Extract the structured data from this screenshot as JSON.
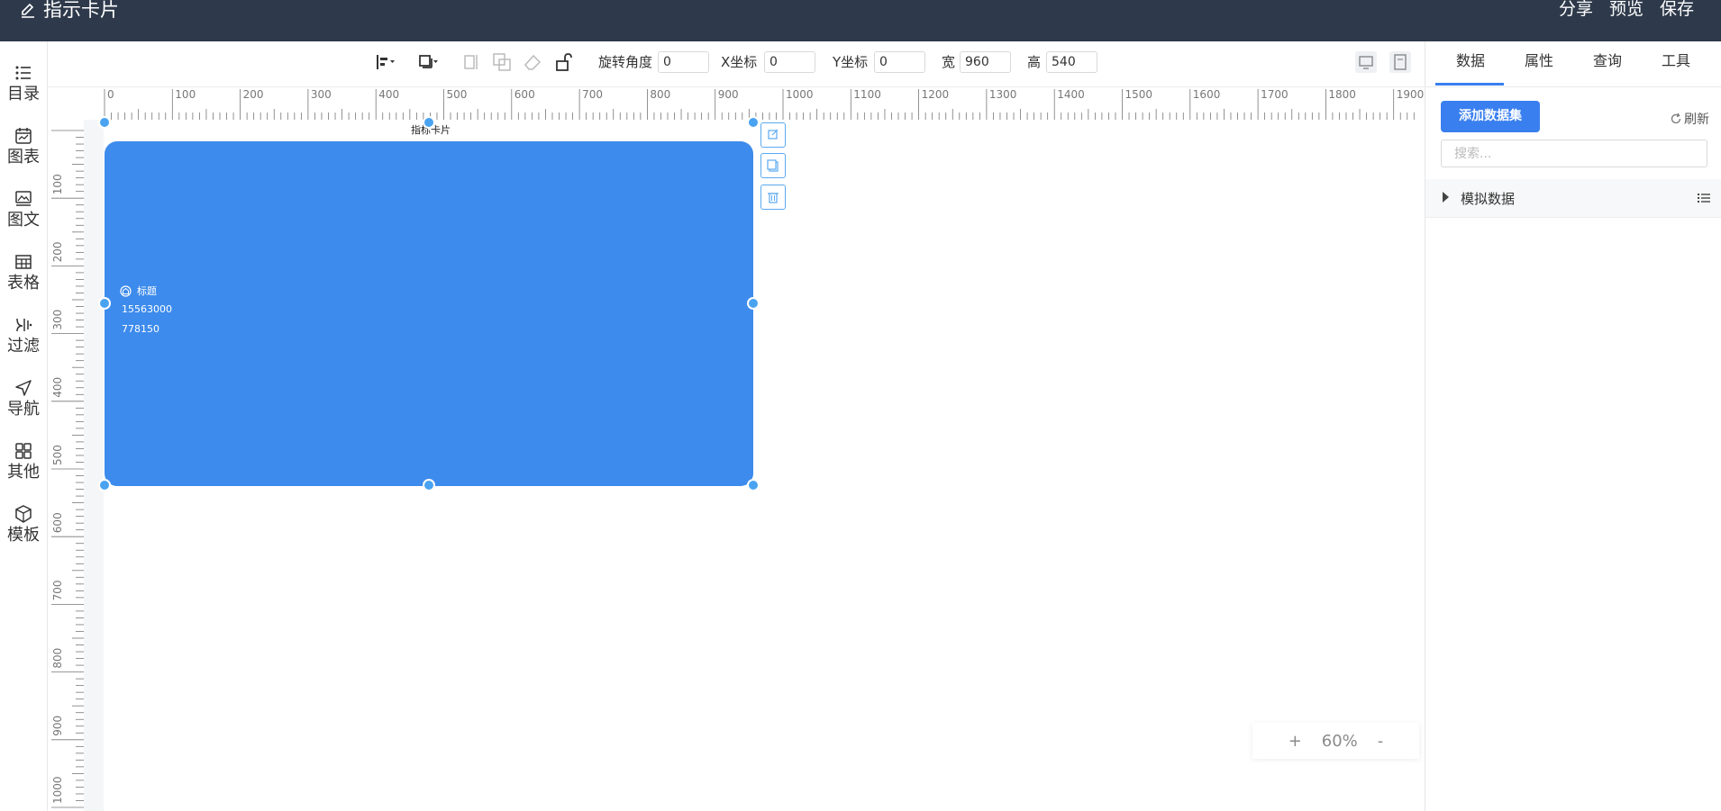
{
  "app": {
    "title": "指示卡片",
    "actions": [
      "分享",
      "预览",
      "保存"
    ]
  },
  "leftnav": [
    {
      "label": "目录",
      "icon": "list-icon"
    },
    {
      "label": "图表",
      "icon": "calendar-chart-icon"
    },
    {
      "label": "图文",
      "icon": "image-text-icon"
    },
    {
      "label": "表格",
      "icon": "table-icon"
    },
    {
      "label": "过滤",
      "icon": "filter-icon"
    },
    {
      "label": "导航",
      "icon": "navigation-icon"
    },
    {
      "label": "其他",
      "icon": "grid-icon"
    },
    {
      "label": "模板",
      "icon": "template-icon"
    }
  ],
  "toolbar": {
    "rotation_label": "旋转角度",
    "rotation_value": "0",
    "x_label": "X坐标",
    "x_value": "0",
    "y_label": "Y坐标",
    "y_value": "0",
    "width_label": "宽",
    "width_value": "960",
    "height_label": "高",
    "height_value": "540"
  },
  "ruler": {
    "top_labels": [
      "0",
      "100",
      "200",
      "300",
      "400",
      "500",
      "600",
      "700",
      "800",
      "900",
      "1000",
      "1100",
      "1200",
      "1300",
      "1400",
      "1500",
      "1600",
      "1700",
      "1800",
      "1900"
    ],
    "left_labels": [
      "100",
      "200",
      "300",
      "400",
      "500",
      "600",
      "700",
      "800",
      "900",
      "1000"
    ]
  },
  "card": {
    "caption": "指标卡片",
    "title": "标题",
    "value1": "15563000",
    "value2": "778150",
    "color": "#3d8bec"
  },
  "zoom": {
    "plus": "+",
    "level": "60%",
    "minus": "-"
  },
  "right_panel": {
    "tabs": [
      "数据",
      "属性",
      "查询",
      "工具"
    ],
    "active_tab": "数据",
    "add_dataset_label": "添加数据集",
    "refresh_label": "刷新",
    "search_placeholder": "搜索...",
    "tree_item": "模拟数据"
  },
  "colors": {
    "topbar": "#2e3a4b",
    "accent": "#3a7fef",
    "handle": "#4aa3f0"
  }
}
